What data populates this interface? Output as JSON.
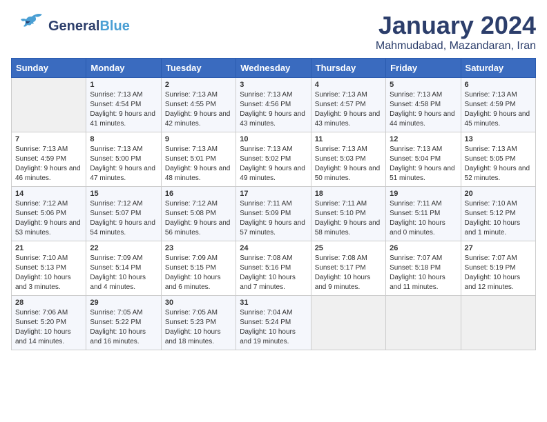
{
  "header": {
    "logo_general": "General",
    "logo_blue": "Blue",
    "month": "January 2024",
    "location": "Mahmudabad, Mazandaran, Iran"
  },
  "days_of_week": [
    "Sunday",
    "Monday",
    "Tuesday",
    "Wednesday",
    "Thursday",
    "Friday",
    "Saturday"
  ],
  "weeks": [
    [
      {
        "day": "",
        "empty": true
      },
      {
        "day": "1",
        "sunrise": "7:13 AM",
        "sunset": "4:54 PM",
        "daylight": "9 hours and 41 minutes."
      },
      {
        "day": "2",
        "sunrise": "7:13 AM",
        "sunset": "4:55 PM",
        "daylight": "9 hours and 42 minutes."
      },
      {
        "day": "3",
        "sunrise": "7:13 AM",
        "sunset": "4:56 PM",
        "daylight": "9 hours and 43 minutes."
      },
      {
        "day": "4",
        "sunrise": "7:13 AM",
        "sunset": "4:57 PM",
        "daylight": "9 hours and 43 minutes."
      },
      {
        "day": "5",
        "sunrise": "7:13 AM",
        "sunset": "4:58 PM",
        "daylight": "9 hours and 44 minutes."
      },
      {
        "day": "6",
        "sunrise": "7:13 AM",
        "sunset": "4:59 PM",
        "daylight": "9 hours and 45 minutes."
      }
    ],
    [
      {
        "day": "7",
        "sunrise": "7:13 AM",
        "sunset": "4:59 PM",
        "daylight": "9 hours and 46 minutes."
      },
      {
        "day": "8",
        "sunrise": "7:13 AM",
        "sunset": "5:00 PM",
        "daylight": "9 hours and 47 minutes."
      },
      {
        "day": "9",
        "sunrise": "7:13 AM",
        "sunset": "5:01 PM",
        "daylight": "9 hours and 48 minutes."
      },
      {
        "day": "10",
        "sunrise": "7:13 AM",
        "sunset": "5:02 PM",
        "daylight": "9 hours and 49 minutes."
      },
      {
        "day": "11",
        "sunrise": "7:13 AM",
        "sunset": "5:03 PM",
        "daylight": "9 hours and 50 minutes."
      },
      {
        "day": "12",
        "sunrise": "7:13 AM",
        "sunset": "5:04 PM",
        "daylight": "9 hours and 51 minutes."
      },
      {
        "day": "13",
        "sunrise": "7:13 AM",
        "sunset": "5:05 PM",
        "daylight": "9 hours and 52 minutes."
      }
    ],
    [
      {
        "day": "14",
        "sunrise": "7:12 AM",
        "sunset": "5:06 PM",
        "daylight": "9 hours and 53 minutes."
      },
      {
        "day": "15",
        "sunrise": "7:12 AM",
        "sunset": "5:07 PM",
        "daylight": "9 hours and 54 minutes."
      },
      {
        "day": "16",
        "sunrise": "7:12 AM",
        "sunset": "5:08 PM",
        "daylight": "9 hours and 56 minutes."
      },
      {
        "day": "17",
        "sunrise": "7:11 AM",
        "sunset": "5:09 PM",
        "daylight": "9 hours and 57 minutes."
      },
      {
        "day": "18",
        "sunrise": "7:11 AM",
        "sunset": "5:10 PM",
        "daylight": "9 hours and 58 minutes."
      },
      {
        "day": "19",
        "sunrise": "7:11 AM",
        "sunset": "5:11 PM",
        "daylight": "10 hours and 0 minutes."
      },
      {
        "day": "20",
        "sunrise": "7:10 AM",
        "sunset": "5:12 PM",
        "daylight": "10 hours and 1 minute."
      }
    ],
    [
      {
        "day": "21",
        "sunrise": "7:10 AM",
        "sunset": "5:13 PM",
        "daylight": "10 hours and 3 minutes."
      },
      {
        "day": "22",
        "sunrise": "7:09 AM",
        "sunset": "5:14 PM",
        "daylight": "10 hours and 4 minutes."
      },
      {
        "day": "23",
        "sunrise": "7:09 AM",
        "sunset": "5:15 PM",
        "daylight": "10 hours and 6 minutes."
      },
      {
        "day": "24",
        "sunrise": "7:08 AM",
        "sunset": "5:16 PM",
        "daylight": "10 hours and 7 minutes."
      },
      {
        "day": "25",
        "sunrise": "7:08 AM",
        "sunset": "5:17 PM",
        "daylight": "10 hours and 9 minutes."
      },
      {
        "day": "26",
        "sunrise": "7:07 AM",
        "sunset": "5:18 PM",
        "daylight": "10 hours and 11 minutes."
      },
      {
        "day": "27",
        "sunrise": "7:07 AM",
        "sunset": "5:19 PM",
        "daylight": "10 hours and 12 minutes."
      }
    ],
    [
      {
        "day": "28",
        "sunrise": "7:06 AM",
        "sunset": "5:20 PM",
        "daylight": "10 hours and 14 minutes."
      },
      {
        "day": "29",
        "sunrise": "7:05 AM",
        "sunset": "5:22 PM",
        "daylight": "10 hours and 16 minutes."
      },
      {
        "day": "30",
        "sunrise": "7:05 AM",
        "sunset": "5:23 PM",
        "daylight": "10 hours and 18 minutes."
      },
      {
        "day": "31",
        "sunrise": "7:04 AM",
        "sunset": "5:24 PM",
        "daylight": "10 hours and 19 minutes."
      },
      {
        "day": "",
        "empty": true
      },
      {
        "day": "",
        "empty": true
      },
      {
        "day": "",
        "empty": true
      }
    ]
  ],
  "labels": {
    "sunrise": "Sunrise:",
    "sunset": "Sunset:",
    "daylight": "Daylight:"
  }
}
